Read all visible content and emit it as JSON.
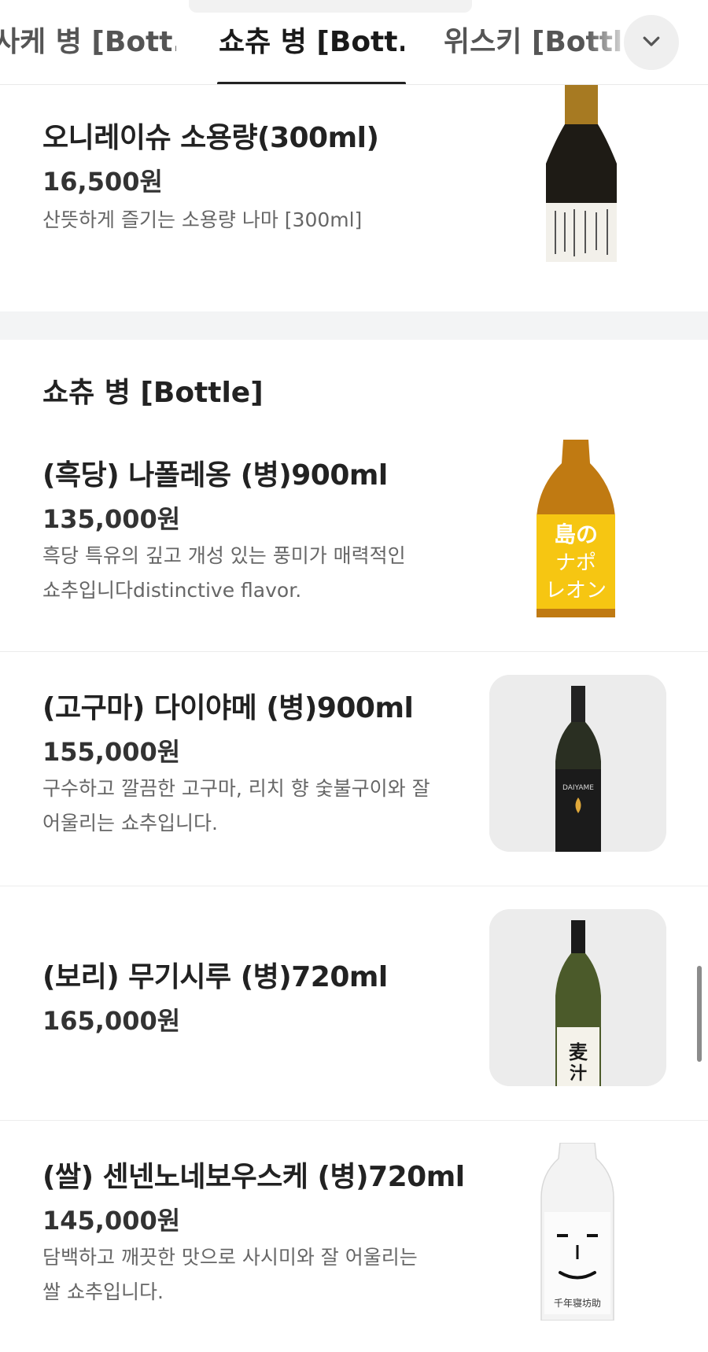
{
  "tabs": [
    {
      "label": "사케 병 [Bott..."
    },
    {
      "label": "쇼츄 병 [Bott..."
    },
    {
      "label": "위스키 [Bottl.."
    }
  ],
  "active_tab_index": 1,
  "expand_icon": "chevron-down-icon",
  "items_top": [
    {
      "name": "오니레이슈 소용량(300ml)",
      "price": "16,500원",
      "desc": "산뜻하게 즐기는 소용량 나마 [300ml]"
    }
  ],
  "section": {
    "title": "쇼츄 병 [Bottle]",
    "items": [
      {
        "name": "(흑당) 나폴레옹 (병)900ml",
        "price": "135,000원",
        "desc_line1": "흑당 특유의 깊고 개성 있는 풍미가 매력적인",
        "desc_line2": "쇼추입니다distinctive flavor.",
        "label_text": "島のナポレオン"
      },
      {
        "name": "(고구마) 다이야메 (병)900ml",
        "price": "155,000원",
        "desc_line1": "구수하고 깔끔한 고구마, 리치 향 숯불구이와 잘",
        "desc_line2": "어울리는 쇼추입니다.",
        "label_text": "DAIYAME"
      },
      {
        "name": "(보리) 무기시루 (병)720ml",
        "price": "165,000원",
        "label_text": "麦汁"
      },
      {
        "name": "(쌀) 센넨노네보우스케 (병)720ml",
        "price": "145,000원",
        "desc_line1": "담백하고 깨끗한 맛으로 사시미와 잘 어울리는",
        "desc_line2": "쌀 쇼추입니다.",
        "label_text": "千年寝坊助"
      }
    ]
  },
  "colors": {
    "accent": "#222222",
    "section_gap": "#f3f4f5",
    "thumb_bg": "#ececec"
  }
}
